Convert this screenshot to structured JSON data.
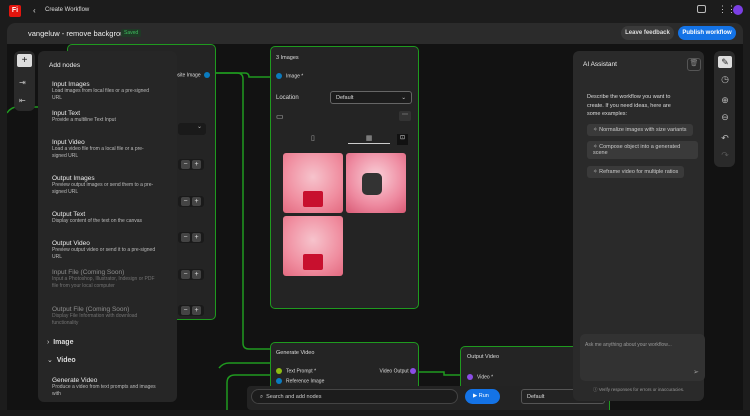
{
  "app": {
    "logo": "Fi",
    "back_label": "Create Workflow"
  },
  "header": {
    "title": "vangeluw - remove background",
    "status": "Saved",
    "feedback": "Leave feedback",
    "publish": "Publish workflow"
  },
  "add_nodes": {
    "title": "Add nodes",
    "items": [
      {
        "name": "Input Images",
        "desc": "Load images from local files or a pre-signed URL"
      },
      {
        "name": "Input Text",
        "desc": "Provide a multiline Text Input"
      },
      {
        "name": "Input Video",
        "desc": "Load a video file from a local file or a pre-signed URL"
      },
      {
        "name": "Output Images",
        "desc": "Preview output images or send them to a pre-signed URL"
      },
      {
        "name": "Output Text",
        "desc": "Display content of the text on the canvas"
      },
      {
        "name": "Output Video",
        "desc": "Preview output video or send it to a pre-signed URL"
      },
      {
        "name": "Input File (Coming Soon)",
        "desc": "Input a Photoshop, Illustrator, Indesign or PDF file from your local computer"
      },
      {
        "name": "Output File (Coming Soon)",
        "desc": "Display File Information with download functionality"
      }
    ],
    "sections": [
      "Image",
      "Video"
    ],
    "video_item": {
      "name": "Generate Video",
      "desc": "Produce a video from text prompts and images with"
    }
  },
  "hidden_node": {
    "port": "osite Image"
  },
  "images_node": {
    "title": "3 Images",
    "port": "Image *",
    "location_label": "Location",
    "location_value": "Default"
  },
  "generate_video": {
    "title": "Generate Video",
    "inputs": [
      "Text Prompt *",
      "Reference Image"
    ],
    "output": "Video Output"
  },
  "output_video": {
    "title": "Output Video",
    "input": "Video *"
  },
  "bottom": {
    "search_placeholder": "Search and add nodes",
    "run": "Run",
    "select": "Default"
  },
  "assistant": {
    "title": "AI Assistant",
    "intro": "Describe the workflow you want to create. If you need ideas, here are some examples:",
    "examples": [
      "Normalize images with size variants",
      "Compose object into a generated scene",
      "Reframe video for multiple ratios"
    ],
    "input_placeholder": "Ask me anything about your workflow...",
    "disclaimer": "Verify responses for errors or inaccuracies."
  },
  "colors": {
    "accent": "#1473e6",
    "edge": "#1f9a1f",
    "port_blue": "#0a7bbf",
    "port_green": "#8dbb12",
    "port_purple": "#8b4de6"
  }
}
